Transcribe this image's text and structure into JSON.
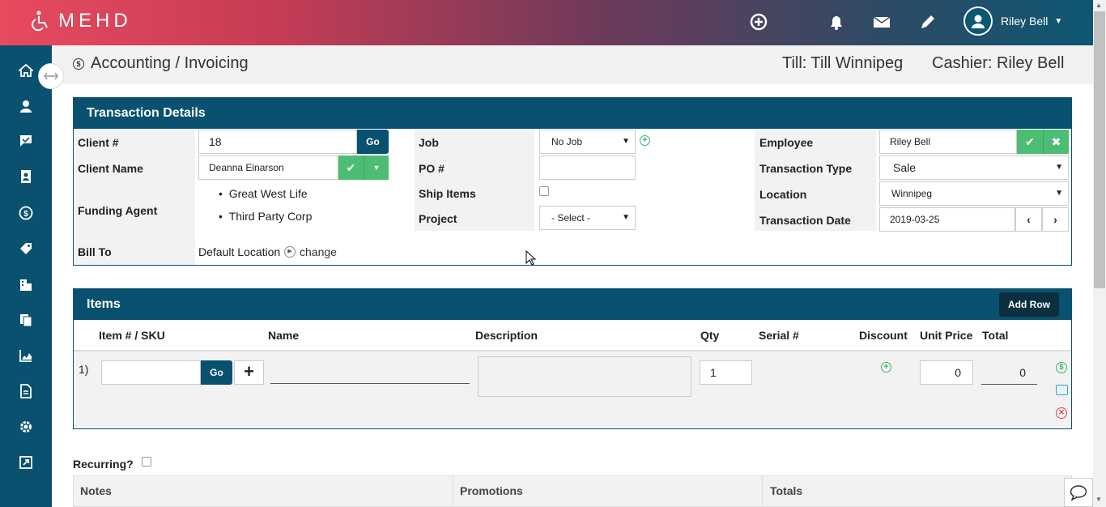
{
  "app": {
    "brand": "MEHD"
  },
  "header": {
    "user_name": "Riley Bell"
  },
  "page": {
    "title": "Accounting / Invoicing",
    "till": "Till: Till Winnipeg",
    "cashier": "Cashier: Riley Bell"
  },
  "transaction": {
    "heading": "Transaction Details",
    "client_num_label": "Client #",
    "client_num_value": "18",
    "go_label": "Go",
    "client_name_label": "Client Name",
    "client_name_value": "Deanna Einarson",
    "funding_label": "Funding Agent",
    "funding_agents": [
      "Great West Life",
      "Third Party Corp"
    ],
    "bill_to_label": "Bill To",
    "bill_to_value": "Default Location",
    "change_label": "change",
    "job_label": "Job",
    "job_value": "No Job",
    "po_label": "PO #",
    "po_value": "",
    "ship_label": "Ship Items",
    "project_label": "Project",
    "project_value": "- Select -",
    "employee_label": "Employee",
    "employee_value": "Riley Bell",
    "ttype_label": "Transaction Type",
    "ttype_value": "Sale",
    "location_label": "Location",
    "location_value": "Winnipeg",
    "tdate_label": "Transaction Date",
    "tdate_value": "2019-03-25"
  },
  "items": {
    "heading": "Items",
    "add_row_label": "Add Row",
    "columns": [
      "Item # / SKU",
      "Name",
      "Description",
      "Qty",
      "Serial #",
      "Discount",
      "Unit Price",
      "Total"
    ],
    "row": {
      "index": "1)",
      "sku": "",
      "go_label": "Go",
      "qty": "1",
      "unit_price": "0",
      "total": "0"
    }
  },
  "recurring_label": "Recurring?",
  "bottom": {
    "notes": "Notes",
    "promotions": "Promotions",
    "totals": "Totals"
  },
  "colors": {
    "primary": "#0a5170",
    "green": "#4cbd72",
    "danger": "#e0404a"
  }
}
